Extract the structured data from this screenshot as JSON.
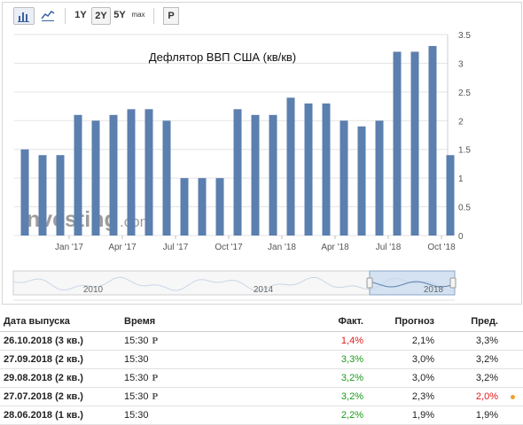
{
  "toolbar": {
    "bar_chart_icon": "bar-chart-icon",
    "line_chart_icon": "line-chart-icon",
    "range_1y": "1Y",
    "range_2y": "2Y",
    "range_5y": "5Y",
    "range_max": "max",
    "p_button": "P"
  },
  "chart_data": {
    "type": "bar",
    "title": "Дефлятор ВВП США (кв/кв)",
    "values": [
      1.5,
      1.4,
      1.4,
      2.1,
      2.0,
      2.1,
      2.2,
      2.2,
      2.0,
      1.0,
      1.0,
      1.0,
      2.2,
      2.1,
      2.1,
      2.4,
      2.3,
      2.3,
      2.0,
      1.9,
      2.0,
      3.2,
      3.2,
      3.3,
      1.4
    ],
    "x_tick_labels": [
      "Jan '17",
      "Apr '17",
      "Jul '17",
      "Oct '17",
      "Jan '18",
      "Apr '18",
      "Jul '18",
      "Oct '18"
    ],
    "y_tick_labels": [
      "0",
      "0.5",
      "1",
      "1.5",
      "2",
      "2.5",
      "3",
      "3.5"
    ],
    "ylim": [
      0,
      3.5
    ],
    "bar_color": "#5b7fae",
    "grid": true,
    "watermark": "Investing.com",
    "navigator_labels": [
      "2010",
      "2014",
      "2018"
    ]
  },
  "table": {
    "headers": [
      "Дата выпуска",
      "Время",
      "Факт.",
      "Прогноз",
      "Пред."
    ],
    "rows": [
      {
        "date": "26.10.2018 (3 кв.)",
        "time": "15:30",
        "p": "P",
        "actual": "1,4%",
        "actual_color": "red",
        "forecast": "2,1%",
        "previous": "3,3%",
        "prev_color": "",
        "dot": false
      },
      {
        "date": "27.09.2018 (2 кв.)",
        "time": "15:30",
        "p": "",
        "actual": "3,3%",
        "actual_color": "green",
        "forecast": "3,0%",
        "previous": "3,2%",
        "prev_color": "",
        "dot": false
      },
      {
        "date": "29.08.2018 (2 кв.)",
        "time": "15:30",
        "p": "P",
        "actual": "3,2%",
        "actual_color": "green",
        "forecast": "3,0%",
        "previous": "3,2%",
        "prev_color": "",
        "dot": false
      },
      {
        "date": "27.07.2018 (2 кв.)",
        "time": "15:30",
        "p": "P",
        "actual": "3,2%",
        "actual_color": "green",
        "forecast": "2,3%",
        "previous": "2,0%",
        "prev_color": "red",
        "dot": true
      },
      {
        "date": "28.06.2018 (1 кв.)",
        "time": "15:30",
        "p": "",
        "actual": "2,2%",
        "actual_color": "green",
        "forecast": "1,9%",
        "previous": "1,9%",
        "prev_color": "",
        "dot": false
      }
    ]
  }
}
